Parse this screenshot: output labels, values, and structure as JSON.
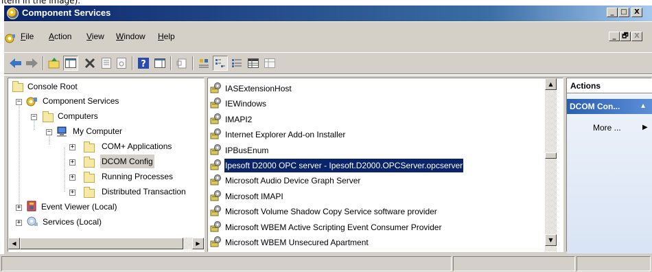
{
  "top_remnant": "item in the image).",
  "window": {
    "title": "Component Services",
    "controls": [
      "_",
      "□",
      "X"
    ]
  },
  "menu": {
    "items": [
      "File",
      "Action",
      "View",
      "Window",
      "Help"
    ],
    "mdi_controls": [
      "_",
      "🗗",
      "X"
    ]
  },
  "toolbar": {
    "buttons": [
      "back-icon",
      "forward-icon",
      "up-folder-icon",
      "show-hide-tree-icon",
      "delete-icon",
      "properties-icon",
      "refresh-icon",
      "help-icon",
      "show-hide-action-pane-icon",
      "new-window-icon",
      "large-icons-icon",
      "small-icons-icon",
      "list-view-icon",
      "details-view-icon",
      "configure-icon"
    ]
  },
  "tree": {
    "items": [
      {
        "label": "Console Root",
        "icon": "folder-icon",
        "level": 0,
        "expander": ""
      },
      {
        "label": "Component Services",
        "icon": "component-services-icon",
        "level": 1,
        "expander": "−"
      },
      {
        "label": "Computers",
        "icon": "folder-icon",
        "level": 2,
        "expander": "−"
      },
      {
        "label": "My Computer",
        "icon": "computer-icon",
        "level": 3,
        "expander": "−"
      },
      {
        "label": "COM+ Applications",
        "icon": "folder-icon",
        "level": 4,
        "expander": "+"
      },
      {
        "label": "DCOM Config",
        "icon": "folder-icon",
        "level": 4,
        "expander": "+"
      },
      {
        "label": "Running Processes",
        "icon": "folder-icon",
        "level": 4,
        "expander": "+"
      },
      {
        "label": "Distributed Transaction",
        "icon": "folder-icon",
        "level": 4,
        "expander": "+"
      },
      {
        "label": "Event Viewer (Local)",
        "icon": "event-viewer-icon",
        "level": 0,
        "expander": "+"
      },
      {
        "label": "Services (Local)",
        "icon": "services-icon",
        "level": 0,
        "expander": "+"
      }
    ]
  },
  "list": {
    "items": [
      {
        "label": "IASExtensionHost",
        "selected": false
      },
      {
        "label": "IEWindows",
        "selected": false
      },
      {
        "label": "IMAPI2",
        "selected": false
      },
      {
        "label": "Internet Explorer Add-on Installer",
        "selected": false
      },
      {
        "label": "IPBusEnum",
        "selected": false
      },
      {
        "label": "Ipesoft D2000 OPC server - Ipesoft.D2000.OPCServer.opcserver",
        "selected": true
      },
      {
        "label": "Microsoft Audio Device Graph Server",
        "selected": false
      },
      {
        "label": "Microsoft IMAPI",
        "selected": false
      },
      {
        "label": "Microsoft Volume Shadow Copy Service software provider",
        "selected": false
      },
      {
        "label": "Microsoft WBEM Active Scripting Event Consumer Provider",
        "selected": false
      },
      {
        "label": "Microsoft WBEM Unsecured Apartment",
        "selected": false
      }
    ]
  },
  "actions": {
    "header": "Actions",
    "section_title": "DCOM Con...",
    "more": "More ..."
  },
  "colors": {
    "titlebar_start": "#0a246a",
    "titlebar_end": "#a6caf0",
    "selection": "#0a246a",
    "actions_title": "#2a5fb0"
  }
}
